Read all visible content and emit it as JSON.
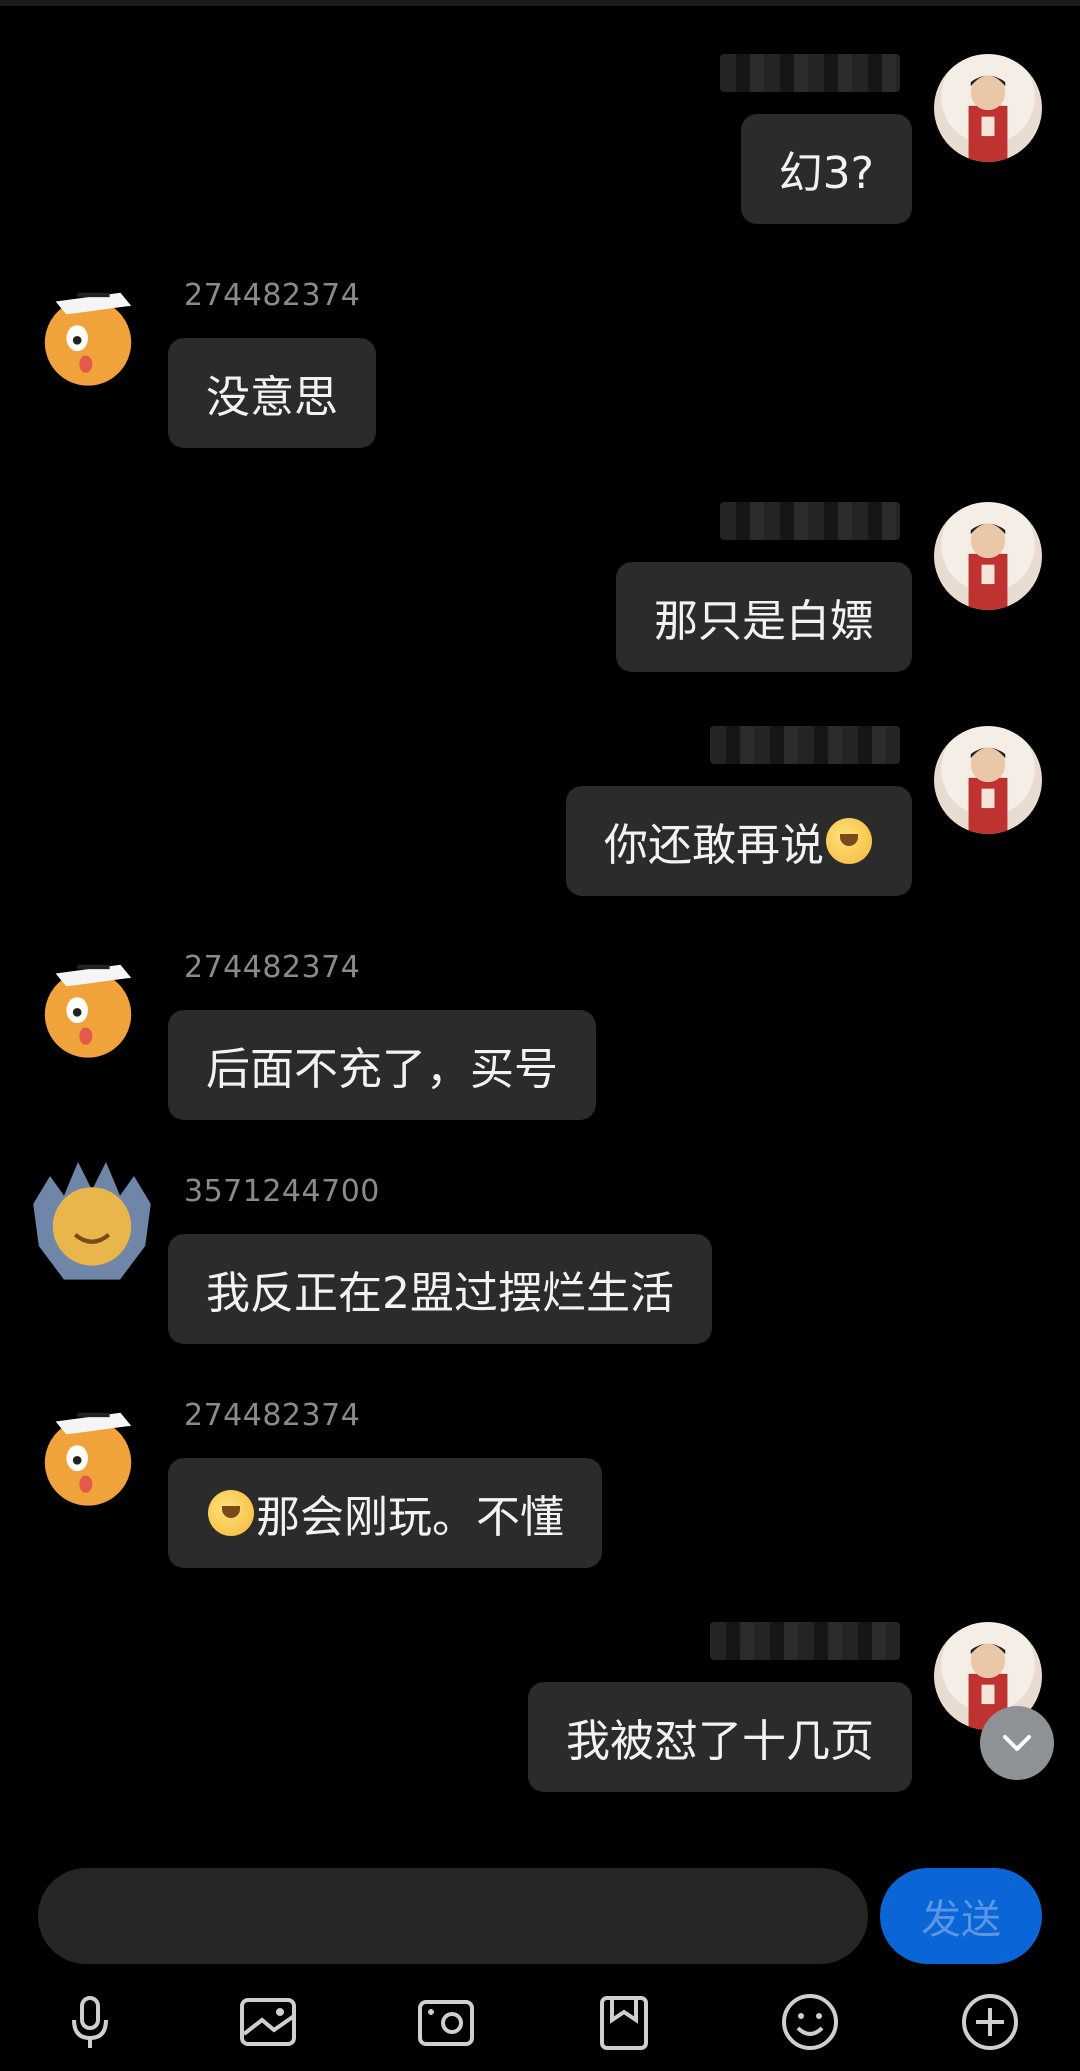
{
  "messages": [
    {
      "direction": "out",
      "text": "幻3?"
    },
    {
      "direction": "in",
      "sender": "274482374",
      "text": "没意思"
    },
    {
      "direction": "out",
      "text": "那只是白嫖"
    },
    {
      "direction": "out",
      "text": "你还敢再说"
    },
    {
      "direction": "in",
      "sender": "274482374",
      "text": "后面不充了，买号"
    },
    {
      "direction": "in",
      "sender": "3571244700",
      "text": "我反正在2盟过摆烂生活"
    },
    {
      "direction": "in",
      "sender": "274482374",
      "text": "那会刚玩。不懂"
    },
    {
      "direction": "out",
      "text": "我被怼了十几页"
    }
  ],
  "composer": {
    "send_label": "发送",
    "placeholder": ""
  },
  "toolbar_icons": [
    "microphone-icon",
    "image-icon",
    "camera-icon",
    "file-icon",
    "emoji-icon",
    "plus-icon"
  ],
  "colors": {
    "background": "#000000",
    "bubble": "#2b2b2b",
    "send": "#0a66d6"
  }
}
